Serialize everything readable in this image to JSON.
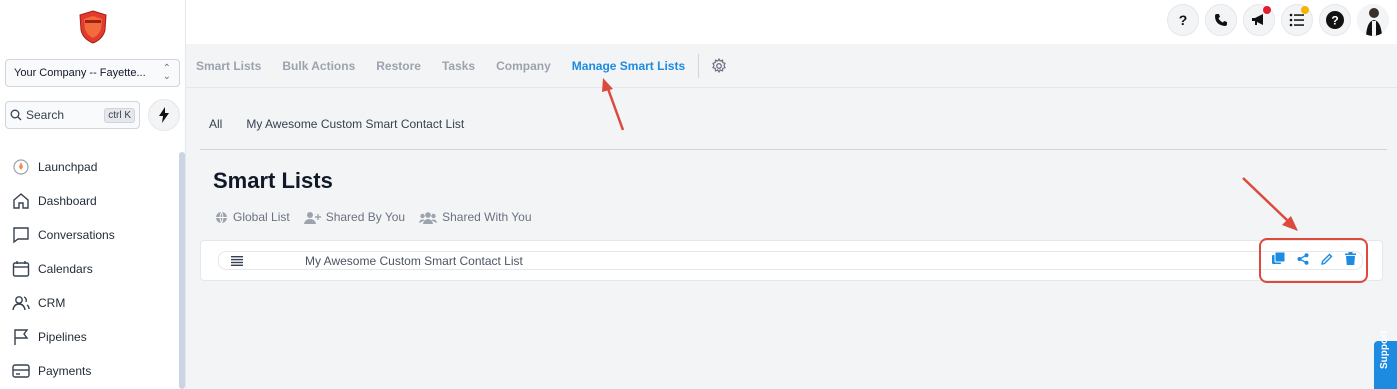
{
  "sidebar": {
    "company": "Your Company -- Fayette...",
    "search_label": "Search",
    "search_shortcut": "ctrl K",
    "items": [
      {
        "label": "Launchpad",
        "icon": "rocket-icon"
      },
      {
        "label": "Dashboard",
        "icon": "home-icon"
      },
      {
        "label": "Conversations",
        "icon": "chat-icon"
      },
      {
        "label": "Calendars",
        "icon": "calendar-icon"
      },
      {
        "label": "CRM",
        "icon": "users-icon"
      },
      {
        "label": "Pipelines",
        "icon": "flag-icon"
      },
      {
        "label": "Payments",
        "icon": "credit-card-icon"
      }
    ]
  },
  "header": {
    "help_label": "?",
    "icons": [
      "help-icon",
      "phone-icon",
      "megaphone-icon",
      "tasks-icon",
      "support-icon",
      "avatar"
    ],
    "notification_colors": {
      "megaphone": "#e11d2e",
      "tasks": "#f5b400"
    }
  },
  "tabs": {
    "items": [
      "Smart Lists",
      "Bulk Actions",
      "Restore",
      "Tasks",
      "Company",
      "Manage Smart Lists"
    ],
    "active": "Manage Smart Lists"
  },
  "filters": [
    "All",
    "My Awesome Custom Smart Contact List"
  ],
  "main": {
    "title": "Smart Lists",
    "scopes": [
      "Global List",
      "Shared By You",
      "Shared With You"
    ],
    "lists": [
      {
        "name": "My Awesome Custom Smart Contact List"
      }
    ],
    "row_actions": [
      "copy-icon",
      "share-icon",
      "edit-icon",
      "delete-icon"
    ]
  },
  "support_tab": "Support",
  "colors": {
    "accent": "#1d8be0",
    "annotation": "#dc4a3d"
  }
}
